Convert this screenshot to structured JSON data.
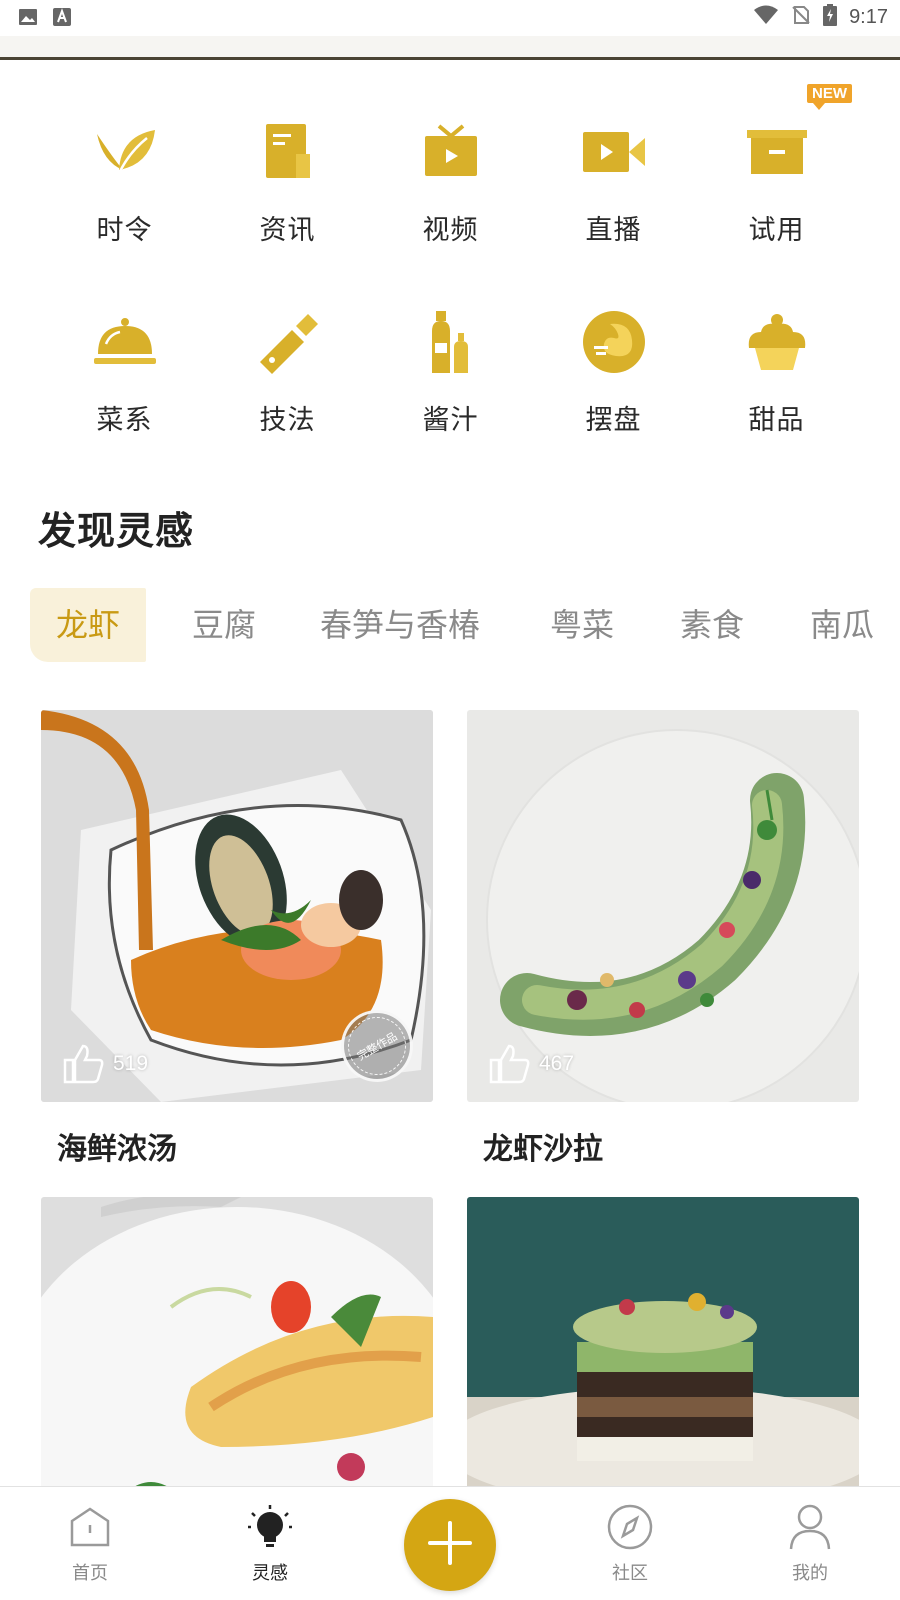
{
  "status_bar": {
    "time": "9:17",
    "left_icons": [
      "image-icon",
      "text-a-icon"
    ],
    "right_icons": [
      "wifi-icon",
      "no-sim-icon",
      "battery-charging-icon"
    ]
  },
  "categories": {
    "new_badge": "NEW",
    "row1": [
      {
        "label": "时令",
        "icon": "leaf-icon"
      },
      {
        "label": "资讯",
        "icon": "news-icon"
      },
      {
        "label": "视频",
        "icon": "tv-play-icon"
      },
      {
        "label": "直播",
        "icon": "video-camera-icon"
      },
      {
        "label": "试用",
        "icon": "box-icon"
      }
    ],
    "row2": [
      {
        "label": "菜系",
        "icon": "cloche-icon"
      },
      {
        "label": "技法",
        "icon": "cleaver-icon"
      },
      {
        "label": "酱汁",
        "icon": "sauce-bottles-icon"
      },
      {
        "label": "摆盘",
        "icon": "plate-icon"
      },
      {
        "label": "甜品",
        "icon": "cupcake-icon"
      }
    ]
  },
  "section": {
    "title": "发现灵感"
  },
  "tags": [
    "龙虾",
    "豆腐",
    "春笋与香椿",
    "粤菜",
    "素食",
    "南瓜"
  ],
  "active_tag": "龙虾",
  "cards": [
    {
      "title": "海鲜浓汤",
      "likes": "519",
      "stamp": "完整作品"
    },
    {
      "title": "龙虾沙拉",
      "likes": "467"
    },
    {
      "title": "",
      "likes": ""
    },
    {
      "title": "",
      "likes": ""
    }
  ],
  "bottom_nav": {
    "home": "首页",
    "inspiration": "灵感",
    "community": "社区",
    "mine": "我的"
  },
  "colors": {
    "accent": "#d4a613",
    "icon_gold": "#d8b02a",
    "tag_active_bg": "#f9f1da",
    "tag_active_text": "#c99a14"
  }
}
